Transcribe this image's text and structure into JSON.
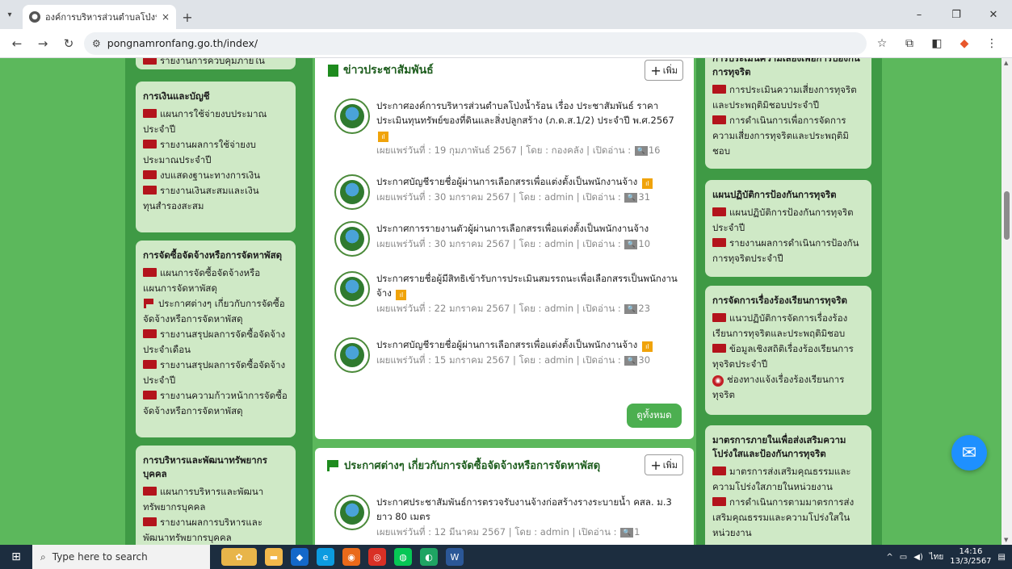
{
  "browser": {
    "tab_title": "องค์การบริหารส่วนตำบลโป่งน้ำร้อน อ.",
    "tab_close": "×",
    "new_tab": "+",
    "url": "pongnamronfang.go.th/index/"
  },
  "left": {
    "top_partial_item": "รายงานการควบคุมภายใน",
    "finance": {
      "title": "การเงินและบัญชี",
      "items": [
        "แผนการใช้จ่ายงบประมาณประจำปี",
        "รายงานผลการใช้จ่ายงบประมาณประจำปี",
        "งบแสดงฐานะทางการเงิน",
        "รายงานเงินสะสมและเงินทุนสำรองสะสม"
      ]
    },
    "procurement": {
      "title": "การจัดซื้อจัดจ้างหรือการจัดหาพัสดุ",
      "items": [
        "แผนการจัดซื้อจัดจ้างหรือแผนการจัดหาพัสดุ",
        "ประกาศต่างๆ เกี่ยวกับการจัดซื้อจัดจ้างหรือการจัดหาพัสดุ",
        "รายงานสรุปผลการจัดซื้อจัดจ้างประจำเดือน",
        "รายงานสรุปผลการจัดซื้อจัดจ้างประจำปี",
        "รายงานความก้าวหน้าการจัดซื้อจัดจ้างหรือการจัดหาพัสดุ"
      ]
    },
    "hr": {
      "title": "การบริหารและพัฒนาทรัพยากรบุคคล",
      "items": [
        "แผนการบริหารและพัฒนาทรัพยากรบุคคล",
        "รายงานผลการบริหารและพัฒนาทรัพยากรบุคคล"
      ]
    }
  },
  "center": {
    "pr": {
      "title": "ข่าวประชาสัมพันธ์",
      "add_label": "เพิ่ม",
      "view_all": "ดูทั้งหมด",
      "items": [
        {
          "title": "ประกาศองค์การบริหารส่วนตำบลโป่งน้ำร้อน เรื่อง ประชาสัมพันธ์ ราคาประเมินทุนทรัพย์ของที่ดินและสิ่งปลูกสร้าง (ภ.ด.ส.1/2) ประจำปี พ.ศ.2567",
          "meta": "เผยแพร่วันที่ : 19 กุมภาพันธ์ 2567 | โดย : กองคลัง | เปิดอ่าน :",
          "views": "16"
        },
        {
          "title": "ประกาศบัญชีรายชื่อผู้ผ่านการเลือกสรรเพื่อแต่งตั้งเป็นพนักงานจ้าง",
          "meta": "เผยแพร่วันที่ : 30 มกราคม 2567 | โดย : admin | เปิดอ่าน :",
          "views": "31"
        },
        {
          "title": "ประกาศการรายงานตัวผู้ผ่านการเลือกสรรเพื่อแต่งตั้งเป็นพนักงานจ้าง",
          "meta": "เผยแพร่วันที่ : 30 มกราคม 2567 | โดย : admin | เปิดอ่าน :",
          "views": "10"
        },
        {
          "title": "ประกาศรายชื่อผู้มีสิทธิเข้ารับการประเมินสมรรถนะเพื่อเลือกสรรเป็นพนักงานจ้าง",
          "meta": "เผยแพร่วันที่ : 22 มกราคม 2567 | โดย : admin | เปิดอ่าน :",
          "views": "23"
        },
        {
          "title": "ประกาศบัญชีรายชื่อผู้ผ่านการเลือกสรรเพื่อแต่งตั้งเป็นพนักงานจ้าง",
          "meta": "เผยแพร่วันที่ : 15 มกราคม 2567 | โดย : admin | เปิดอ่าน :",
          "views": "30"
        }
      ]
    },
    "proc": {
      "title": "ประกาศต่างๆ เกี่ยวกับการจัดซื้อจัดจ้างหรือการจัดหาพัสดุ",
      "add_label": "เพิ่ม",
      "items": [
        {
          "title": "ประกาศประชาสัมพันธ์การตรวจรับงานจ้างก่อสร้างรางระบายน้ำ คสล. ม.3 ยาว 80 เมตร",
          "meta": "เผยแพร่วันที่ : 12 มีนาคม 2567 | โดย : admin | เปิดอ่าน :",
          "views": "1"
        }
      ]
    }
  },
  "right": {
    "top_partial_title": "การประเมินความเสี่ยงเพื่อการป้องกันการทุจริต",
    "risk_items": [
      "การประเมินความเสี่ยงการทุจริตและประพฤติมิชอบประจำปี",
      "การดำเนินการเพื่อการจัดการความเสี่ยงการทุจริตและประพฤติมิชอบ"
    ],
    "plan": {
      "title": "แผนปฏิบัติการป้องกันการทุจริต",
      "items": [
        "แผนปฏิบัติการป้องกันการทุจริตประจำปี",
        "รายงานผลการดำเนินการป้องกันการทุจริตประจำปี"
      ]
    },
    "complaint": {
      "title": "การจัดการเรื่องร้องเรียนการทุจริต",
      "items": [
        "แนวปฏิบัติการจัดการเรื่องร้องเรียนการทุจริตและประพฤติมิชอบ",
        "ข้อมูลเชิงสถิติเรื่องร้องเรียนการทุจริตประจำปี",
        "ช่องทางแจ้งเรื่องร้องเรียนการทุจริต"
      ]
    },
    "measures": {
      "title": "มาตรการภายในเพื่อส่งเสริมความโปร่งใสและป้องกันการทุจริต",
      "items": [
        "มาตรการส่งเสริมคุณธรรมและความโปร่งใสภายในหน่วยงาน",
        "การดำเนินการตามมาตรการส่งเสริมคุณธรรมและความโปร่งใสในหน่วยงาน"
      ]
    }
  },
  "taskbar": {
    "search_placeholder": "Type here to search",
    "lang": "ไทย",
    "time": "14:16",
    "date": "13/3/2567"
  },
  "colors": {
    "folder": "#b3141c",
    "page_green": "#5cb85c",
    "panel_green": "#cfe9c6"
  }
}
